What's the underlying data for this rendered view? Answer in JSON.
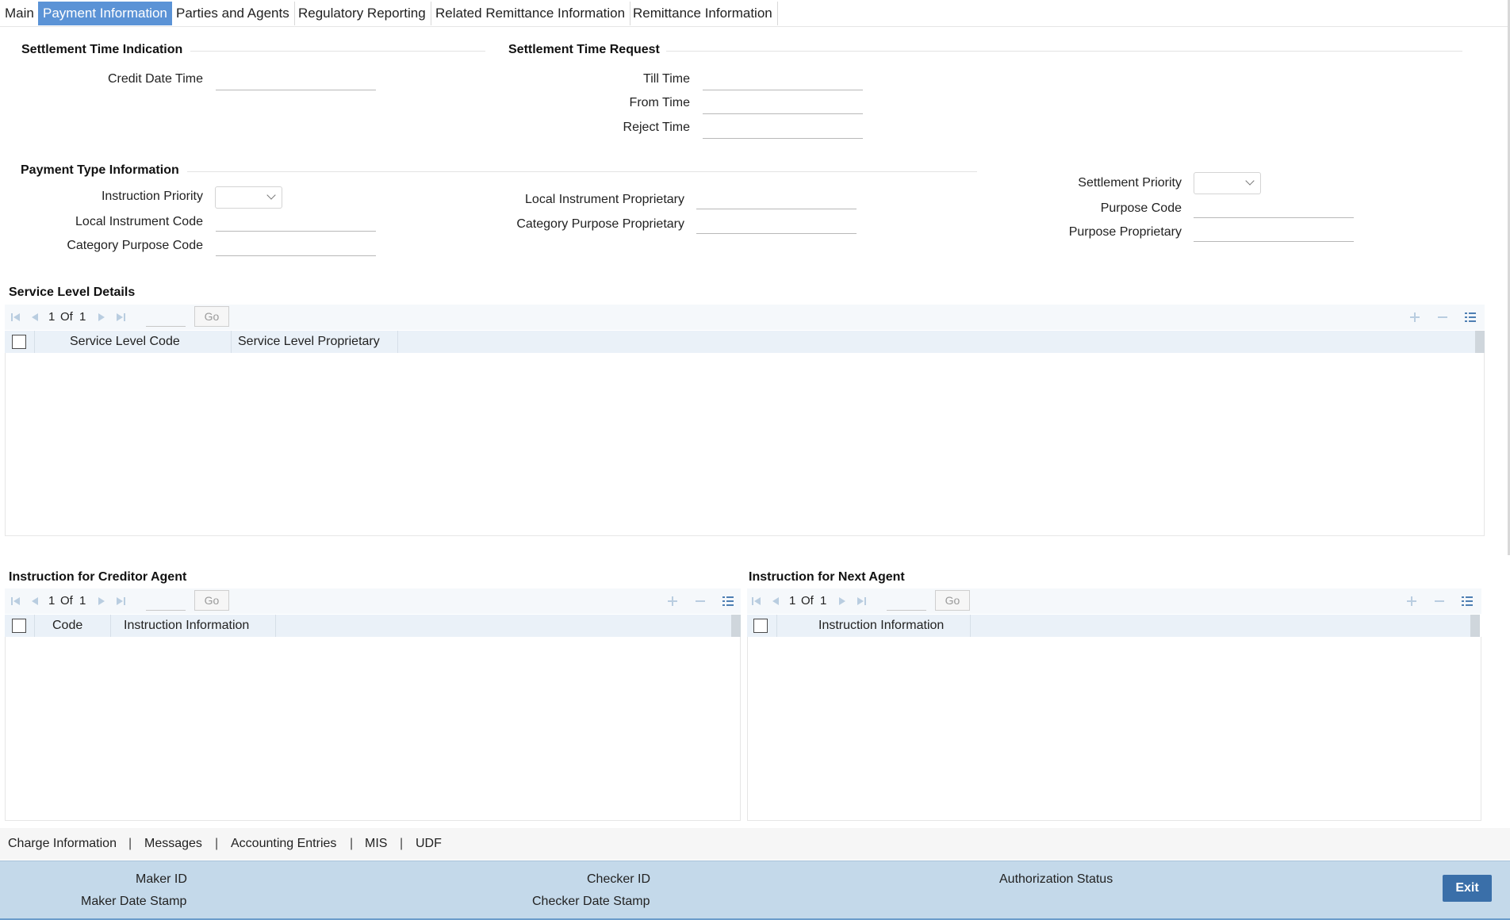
{
  "tabs": [
    {
      "label": "Main"
    },
    {
      "label": "Payment Information",
      "active": true
    },
    {
      "label": "Parties and Agents"
    },
    {
      "label": "Regulatory Reporting"
    },
    {
      "label": "Related Remittance Information"
    },
    {
      "label": "Remittance Information"
    }
  ],
  "settlement_time_indication": {
    "title": "Settlement Time Indication",
    "credit_date_time_label": "Credit Date Time",
    "credit_date_time": ""
  },
  "settlement_time_request": {
    "title": "Settlement Time Request",
    "till_time_label": "Till Time",
    "from_time_label": "From Time",
    "reject_time_label": "Reject Time",
    "till_time": "",
    "from_time": "",
    "reject_time": ""
  },
  "payment_type_information": {
    "title": "Payment Type Information",
    "instruction_priority_label": "Instruction Priority",
    "instruction_priority": "",
    "local_instrument_code_label": "Local Instrument Code",
    "category_purpose_code_label": "Category Purpose Code",
    "local_instrument_proprietary_label": "Local Instrument Proprietary",
    "category_purpose_proprietary_label": "Category Purpose Proprietary",
    "settlement_priority_label": "Settlement Priority",
    "settlement_priority": "",
    "purpose_code_label": "Purpose Code",
    "purpose_proprietary_label": "Purpose Proprietary"
  },
  "service_level_details": {
    "title": "Service Level Details",
    "page": "1",
    "of_label": "Of",
    "total_pages": "1",
    "go_label": "Go",
    "columns": [
      "Service Level Code",
      "Service Level Proprietary"
    ]
  },
  "creditor_agent": {
    "title": "Instruction for Creditor Agent",
    "page": "1",
    "of_label": "Of",
    "total_pages": "1",
    "go_label": "Go",
    "columns": [
      "Code",
      "Instruction Information"
    ]
  },
  "next_agent": {
    "title": "Instruction for Next Agent",
    "page": "1",
    "of_label": "Of",
    "total_pages": "1",
    "go_label": "Go",
    "columns": [
      "Instruction Information"
    ]
  },
  "bottom_links": [
    "Charge Information",
    "Messages",
    "Accounting Entries",
    "MIS",
    "UDF"
  ],
  "link_separator": "|",
  "footer": {
    "maker_id_label": "Maker ID",
    "maker_date_stamp_label": "Maker Date Stamp",
    "checker_id_label": "Checker ID",
    "checker_date_stamp_label": "Checker Date Stamp",
    "authorization_status_label": "Authorization Status",
    "exit_label": "Exit"
  },
  "colors": {
    "active_tab": "#5b93d6",
    "footer_bg": "#c4d9ea",
    "exit_button": "#3a6fa9",
    "grid_header": "#eaf1f8"
  }
}
